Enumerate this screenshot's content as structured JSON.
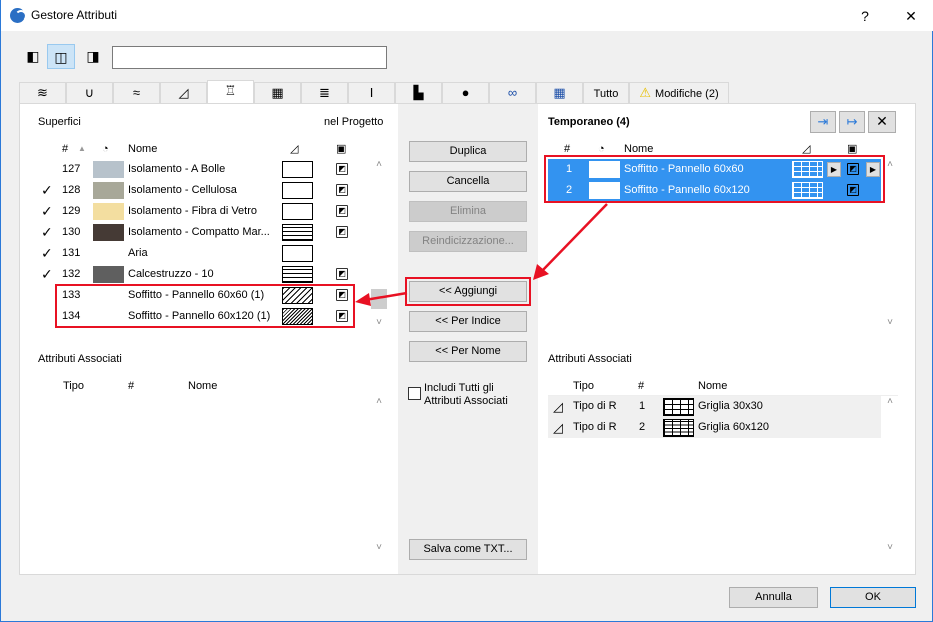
{
  "window": {
    "title": "Gestore Attributi",
    "help": "?",
    "close": "✕"
  },
  "search": {
    "value": "",
    "placeholder": ""
  },
  "tabs": [
    {
      "icon": "layers-icon"
    },
    {
      "icon": "pen-icon"
    },
    {
      "icon": "line-type-icon"
    },
    {
      "icon": "fill-icon"
    },
    {
      "icon": "surface-brush-icon"
    },
    {
      "icon": "building-material-icon"
    },
    {
      "icon": "composite-icon"
    },
    {
      "icon": "profile-icon"
    },
    {
      "icon": "zone-category-icon"
    },
    {
      "icon": "globe-icon"
    },
    {
      "icon": "mep-system-icon"
    },
    {
      "icon": "grid-icon"
    },
    {
      "label": "Tutto"
    },
    {
      "label": "Modifiche (2)",
      "icon": "warning-icon"
    }
  ],
  "left": {
    "title": "Superfici",
    "right_title": "nel Progetto",
    "headers": {
      "num": "#",
      "name": "Nome"
    },
    "rows": [
      {
        "check": "",
        "num": "127",
        "color": "#b7c2cb",
        "name": "Isolamento - A Bolle",
        "pattern": "blank",
        "img": true
      },
      {
        "check": "✓",
        "num": "128",
        "color": "#a8a899",
        "name": "Isolamento - Cellulosa",
        "pattern": "blank",
        "img": true
      },
      {
        "check": "✓",
        "num": "129",
        "color": "#f3dea0",
        "name": "Isolamento - Fibra di Vetro",
        "pattern": "blank",
        "img": true
      },
      {
        "check": "✓",
        "num": "130",
        "color": "#453a35",
        "name": "Isolamento - Compatto Mar...",
        "pattern": "brick",
        "img": true
      },
      {
        "check": "✓",
        "num": "131",
        "color": "",
        "name": "Aria",
        "pattern": "blank",
        "img": false
      },
      {
        "check": "✓",
        "num": "132",
        "color": "#5f5f5f",
        "name": "Calcestruzzo - 10",
        "pattern": "brick",
        "img": true
      },
      {
        "check": "",
        "num": "133",
        "color": "",
        "name": "Soffitto - Pannello 60x60 (1)",
        "pattern": "hatch",
        "img": true
      },
      {
        "check": "",
        "num": "134",
        "color": "",
        "name": "Soffitto - Pannello 60x120 (1)",
        "pattern": "dhatch",
        "img": true
      }
    ],
    "assoc": {
      "title": "Attributi Associati",
      "headers": {
        "tipo": "Tipo",
        "num": "#",
        "name": "Nome"
      }
    }
  },
  "middle": {
    "buttons": [
      "Duplica",
      "Cancella",
      "Elimina",
      "Reindicizzazione...",
      "<< Aggiungi",
      "<< Per Indice",
      "<< Per Nome"
    ],
    "include_all": {
      "line1": "Includi Tutti gli",
      "line2": "Attributi Associati",
      "checked": false
    },
    "save_txt": "Salva come TXT..."
  },
  "right": {
    "title": "Temporaneo (4)",
    "headers": {
      "num": "#",
      "name": "Nome"
    },
    "rows": [
      {
        "num": "1",
        "name": "Soffitto - Pannello 60x60"
      },
      {
        "num": "2",
        "name": "Soffitto - Pannello 60x120"
      }
    ],
    "assoc": {
      "title": "Attributi Associati",
      "headers": {
        "tipo": "Tipo",
        "num": "#",
        "name": "Nome"
      },
      "rows": [
        {
          "tipo": "Tipo di R",
          "num": "1",
          "name": "Griglia 30x30"
        },
        {
          "tipo": "Tipo di R",
          "num": "2",
          "name": "Griglia 60x120"
        }
      ]
    }
  },
  "footer": {
    "cancel": "Annulla",
    "ok": "OK"
  },
  "colors": {
    "selection": "#3393f0",
    "highlight": "#e81123",
    "accent": "#2b79d8"
  }
}
